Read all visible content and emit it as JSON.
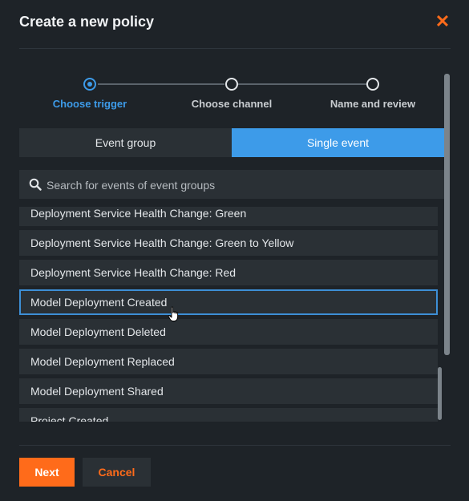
{
  "dialog": {
    "title": "Create a new policy",
    "close_icon": "close-icon"
  },
  "stepper": {
    "steps": [
      {
        "label": "Choose trigger",
        "state": "active"
      },
      {
        "label": "Choose channel",
        "state": "inactive"
      },
      {
        "label": "Name and review",
        "state": "inactive"
      }
    ]
  },
  "toggle": {
    "options": [
      "Event group",
      "Single event"
    ],
    "selected": "Single event"
  },
  "search": {
    "placeholder": "Search for events of event groups",
    "value": "",
    "icon": "search-icon"
  },
  "events": {
    "items": [
      "Deployment Service Health Change: Green",
      "Deployment Service Health Change: Green to Yellow",
      "Deployment Service Health Change: Red",
      "Model Deployment Created",
      "Model Deployment Deleted",
      "Model Deployment Replaced",
      "Model Deployment Shared",
      "Project Created"
    ],
    "highlighted": "Model Deployment Created"
  },
  "footer": {
    "next_label": "Next",
    "cancel_label": "Cancel"
  },
  "colors": {
    "accent_orange": "#ff6b1a",
    "accent_blue": "#3d9be9",
    "background": "#1e2328",
    "surface": "#2a3035"
  }
}
